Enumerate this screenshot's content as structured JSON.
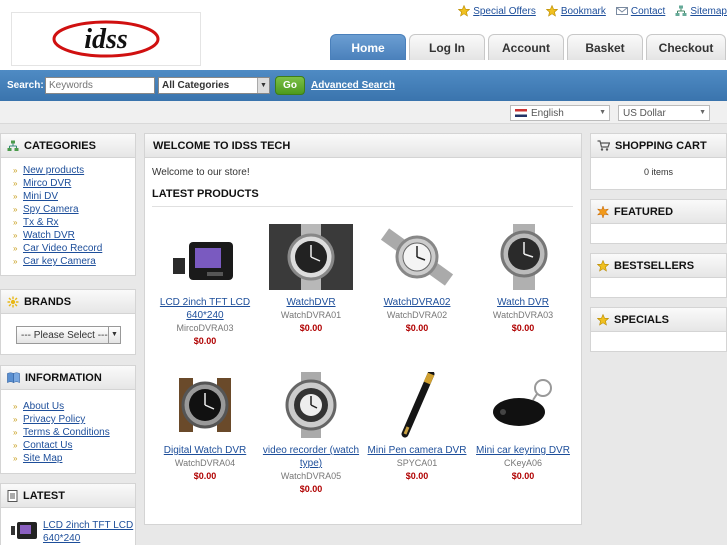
{
  "logo": {
    "text": "idss"
  },
  "top_links": [
    {
      "label": "Special Offers",
      "icon": "star-icon"
    },
    {
      "label": "Bookmark",
      "icon": "bookmark-icon"
    },
    {
      "label": "Contact",
      "icon": "envelope-icon"
    },
    {
      "label": "Sitemap",
      "icon": "sitemap-icon"
    }
  ],
  "tabs": [
    {
      "label": "Home",
      "active": true
    },
    {
      "label": "Log In"
    },
    {
      "label": "Account"
    },
    {
      "label": "Basket"
    },
    {
      "label": "Checkout"
    }
  ],
  "search": {
    "label": "Search:",
    "placeholder": "Keywords",
    "category_selected": "All Categories",
    "go_label": "Go",
    "advanced_label": "Advanced Search"
  },
  "language": {
    "selected": "English"
  },
  "currency": {
    "selected": "US Dollar"
  },
  "categories": {
    "title": "CATEGORIES",
    "items": [
      "New products",
      "Mirco DVR",
      "Mini DV",
      "Spy Camera",
      "Tx & Rx",
      "Watch DVR",
      "Car Video Record",
      "Car key Camera"
    ]
  },
  "brands": {
    "title": "BRANDS",
    "select": "--- Please Select ---"
  },
  "information": {
    "title": "INFORMATION",
    "items": [
      "About Us",
      "Privacy Policy",
      "Terms & Conditions",
      "Contact Us",
      "Site Map"
    ]
  },
  "latest": {
    "title": "LATEST",
    "item_name_line1": "LCD 2inch TFT LCD",
    "item_name_line2": "640*240"
  },
  "main": {
    "title": "WELCOME TO IDSS TECH",
    "welcome": "Welcome to our store!",
    "latest_title": "LATEST PRODUCTS",
    "products": [
      {
        "name": "LCD 2inch TFT LCD 640*240",
        "model": "MircoDVRA03",
        "price": "$0.00"
      },
      {
        "name": "WatchDVR",
        "model": "WatchDVRA01",
        "price": "$0.00"
      },
      {
        "name": "WatchDVRA02",
        "model": "WatchDVRA02",
        "price": "$0.00"
      },
      {
        "name": "Watch DVR",
        "model": "WatchDVRA03",
        "price": "$0.00"
      },
      {
        "name": "Digital Watch DVR",
        "model": "WatchDVRA04",
        "price": "$0.00"
      },
      {
        "name": "video recorder (watch type)",
        "model": "WatchDVRA05",
        "price": "$0.00"
      },
      {
        "name": "Mini Pen camera DVR",
        "model": "SPYCA01",
        "price": "$0.00"
      },
      {
        "name": "Mini car keyring DVR",
        "model": "CKeyA06",
        "price": "$0.00"
      }
    ]
  },
  "cart": {
    "title": "SHOPPING CART",
    "info": "0 items"
  },
  "featured": {
    "title": "FEATURED"
  },
  "bestsellers": {
    "title": "BESTSELLERS"
  },
  "specials": {
    "title": "SPECIALS"
  },
  "colors": {
    "accent": "#3a74ad",
    "go": "#4d9a1f",
    "price": "#b00000",
    "link": "#1d4e9a"
  }
}
